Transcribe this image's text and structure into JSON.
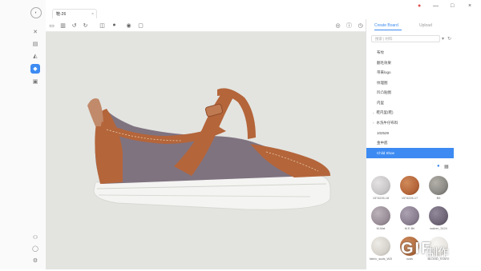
{
  "app": {
    "tab_title": "鞋-26",
    "tab_close": "×"
  },
  "window_controls": {
    "minimize": "—",
    "maximize": "□",
    "close": "×"
  },
  "panel": {
    "tabs": [
      "Create Board",
      "Upload"
    ],
    "search_placeholder": "搜索 | 材料",
    "items": [
      {
        "label": "布纹",
        "type": "item"
      },
      {
        "label": "翻毛效果",
        "type": "item"
      },
      {
        "label": "带来logo",
        "type": "item"
      },
      {
        "label": "纹理图",
        "type": "item"
      },
      {
        "label": "凹凸贴图",
        "type": "item"
      },
      {
        "label": "内里",
        "type": "item"
      },
      {
        "label": "鞋内里(鞋)",
        "type": "folder"
      },
      {
        "label": "水洗牛仔布料",
        "type": "folder"
      },
      {
        "label": "102529",
        "type": "item"
      },
      {
        "label": "金中底",
        "type": "item"
      },
      {
        "label": "Child Shoe",
        "type": "selected"
      }
    ],
    "swatches": [
      {
        "label": "1574226-18",
        "color": "#c9c7c7"
      },
      {
        "label": "1574226-17",
        "color": "#b5663a"
      },
      {
        "label": "B5",
        "color": "#8c8a84"
      },
      {
        "label": "M-Mat",
        "color": "#9a8f98"
      },
      {
        "label": "M.E.Bri",
        "color": "#8a7f90"
      },
      {
        "label": "walzer_3124",
        "color": "#6e6677"
      },
      {
        "label": "fabric_suds_W2L",
        "color": "#d6d3cc"
      },
      {
        "label": "suds",
        "color": "#b26c3e"
      },
      {
        "label": "BLOOD_STATE",
        "color": "#e8e5e0"
      }
    ]
  },
  "leftbar_icons": [
    "logo-icon",
    "cross-icon",
    "save-icon",
    "sole-icon",
    "shoe-icon",
    "folder-icon"
  ],
  "watermark": {
    "text": "GIF",
    "zh": "制作"
  }
}
